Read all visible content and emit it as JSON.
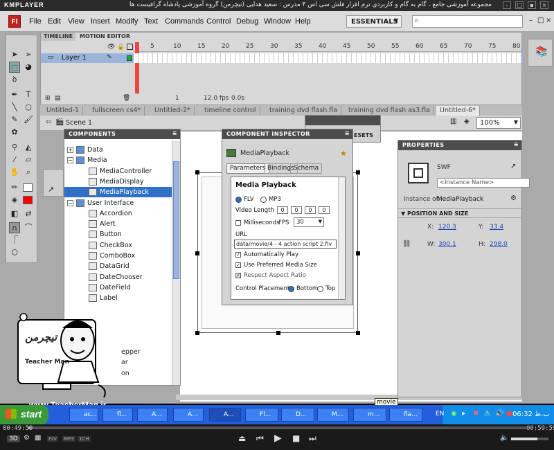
{
  "player": {
    "brand": "KMPLAYER",
    "title": "مجموعه آموزشی جامع ، گام به گام و کاربردی نرم افزار فلش سی اس ۴ مدرس : سعید هدایی (تیچرمن) گروه آموزشی پادشاه گرافیست ها",
    "time_elapsed": "00:49:59",
    "time_total": "00:59:59",
    "format_badges": [
      "FLV",
      "MP3",
      "1CH"
    ],
    "mode_badge": "3D"
  },
  "menu": {
    "logo": "Fl",
    "items": [
      "File",
      "Edit",
      "View",
      "Insert",
      "Modify",
      "Text",
      "Commands",
      "Control",
      "Debug",
      "Window",
      "Help"
    ],
    "workspace": "ESSENTIALS"
  },
  "timeline": {
    "tabs": [
      "TIMELINE",
      "MOTION EDITOR"
    ],
    "layer": "Layer 1",
    "frame_numbers": [
      "5",
      "10",
      "15",
      "20",
      "25",
      "30",
      "35",
      "40",
      "45",
      "50",
      "55",
      "60",
      "65",
      "70",
      "75",
      "80"
    ],
    "frame": "1",
    "fps": "12.0 fps",
    "time": "0.0s"
  },
  "doc_tabs": [
    "Untitled-1",
    "fullscreen cs4*",
    "Untitled-2*",
    "timeline control",
    "training dvd flash.fla",
    "training dvd flash as3.fla",
    "Untitled-6*"
  ],
  "scene": {
    "label": "Scene 1",
    "zoom": "100%"
  },
  "components": {
    "header": "COMPONENTS",
    "items": [
      {
        "label": "Data",
        "level": 0,
        "folder": true,
        "expander": "+"
      },
      {
        "label": "Media",
        "level": 0,
        "folder": true,
        "expander": "−"
      },
      {
        "label": "MediaController",
        "level": 1
      },
      {
        "label": "MediaDisplay",
        "level": 1
      },
      {
        "label": "MediaPlayback",
        "level": 1,
        "selected": true
      },
      {
        "label": "User Interface",
        "level": 0,
        "folder": true,
        "expander": "−"
      },
      {
        "label": "Accordion",
        "level": 1
      },
      {
        "label": "Alert",
        "level": 1
      },
      {
        "label": "Button",
        "level": 1
      },
      {
        "label": "CheckBox",
        "level": 1
      },
      {
        "label": "ComboBox",
        "level": 1
      },
      {
        "label": "DataGrid",
        "level": 1
      },
      {
        "label": "DateChooser",
        "level": 1
      },
      {
        "label": "DateField",
        "level": 1
      },
      {
        "label": "Label",
        "level": 1
      }
    ],
    "partial_items": [
      "epper",
      "ar",
      "on"
    ]
  },
  "presets": {
    "label": "ESETS"
  },
  "inspector": {
    "header": "COMPONENT INSPECTOR",
    "component": "MediaPlayback",
    "tabs": [
      "Parameters",
      "Bindings",
      "Schema"
    ],
    "title": "Media Playback",
    "format_flv": "FLV",
    "format_mp3": "MP3",
    "video_length_label": "Video Length",
    "video_length": [
      "0",
      "0",
      "0",
      "0"
    ],
    "milliseconds_label": "Milliseconds",
    "fps_label": "FPS",
    "fps_value": "30",
    "url_label": "URL",
    "url_value": "data/movie/4 - 4 action script 2.flv",
    "auto_play": "Automatically Play",
    "preferred_size": "Use Preferred Media Size",
    "aspect_ratio": "Respect Aspect Ratio",
    "control_placement": "Control Placement:",
    "bottom": "Bottom",
    "top": "Top"
  },
  "properties": {
    "header": "PROPERTIES",
    "type": "SWF",
    "instance_placeholder": "<Instance Name>",
    "instance_of_label": "Instance of:",
    "instance_of": "MediaPlayback",
    "section": "POSITION AND SIZE",
    "x_label": "X:",
    "x": "120.3",
    "y_label": "Y:",
    "y": "33.4",
    "w_label": "W:",
    "w": "300.1",
    "h_label": "H:",
    "h": "298.0"
  },
  "watermark": {
    "brand": "Teacher Man",
    "persian": "تیچرمن",
    "url": "www.TeacherMan.ir"
  },
  "tooltip": "movie",
  "taskbar": {
    "start": "start",
    "tasks": [
      "ac...",
      "fl...",
      "A...",
      "A...",
      "A...",
      "Fl...",
      "D...",
      "M...",
      "m...",
      "fla..."
    ],
    "lang": "EN",
    "clock": "06:32 ب.ظ"
  },
  "colors": {
    "accent_blue": "#2f6fc5",
    "flash_red": "#c8211b",
    "taskbar_blue": "#245edb",
    "start_green": "#3a9a3a"
  }
}
